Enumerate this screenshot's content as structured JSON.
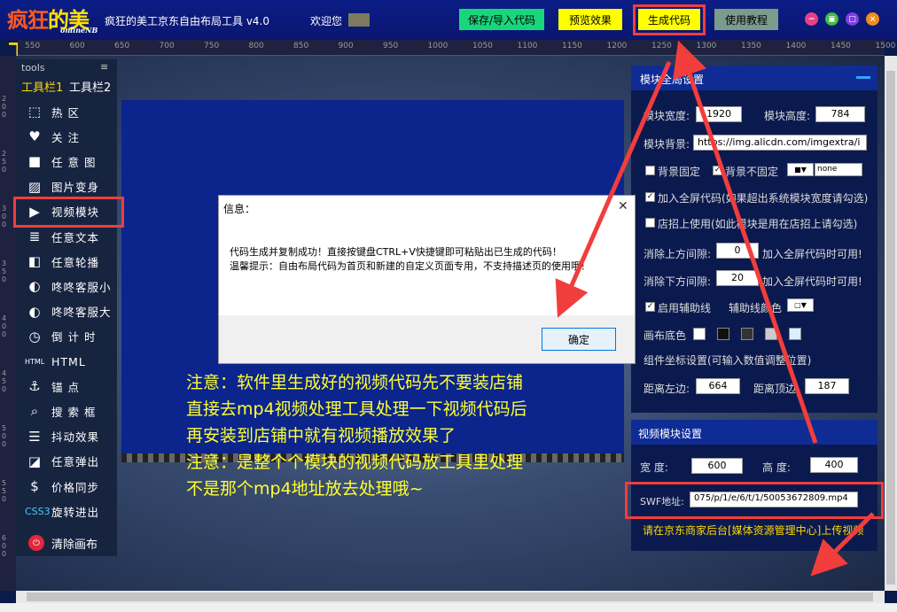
{
  "titlebar": {
    "app_title": "疯狂的美工京东自由布局工具 v4.0",
    "welcome": "欢迎您",
    "logo_main_a": "疯狂",
    "logo_main_b": "的美工",
    "logo_sub": "onlineNB",
    "buttons": {
      "save": "保存/导入代码",
      "preview": "预览效果",
      "generate": "生成代码",
      "tutorial": "使用教程"
    },
    "window": {
      "min": "−",
      "restore": "▣",
      "max": "□",
      "close": "×"
    }
  },
  "ruler_top": [
    "550",
    "600",
    "650",
    "700",
    "750",
    "800",
    "850",
    "900",
    "950",
    "1000",
    "1050",
    "1100",
    "1150",
    "1200",
    "1250",
    "1300",
    "1350",
    "1400",
    "1450",
    "1500"
  ],
  "ruler_left": [
    "200",
    "250",
    "300",
    "350",
    "400",
    "450",
    "500",
    "550",
    "600"
  ],
  "tools": {
    "title": "tools",
    "menu": "≡",
    "tab1": "工具栏1",
    "tab2": "工具栏2",
    "items": [
      {
        "icon": "⬚",
        "label": "热 区"
      },
      {
        "icon": "♥",
        "label": "关 注"
      },
      {
        "icon": "■",
        "label": "任 意 图"
      },
      {
        "icon": "▨",
        "label": "图片变身"
      },
      {
        "icon": "▶",
        "label": "视频模块"
      },
      {
        "icon": "≣",
        "label": "任意文本"
      },
      {
        "icon": "◧",
        "label": "任意轮播"
      },
      {
        "icon": "◐",
        "label": "咚咚客服小"
      },
      {
        "icon": "◐",
        "label": "咚咚客服大"
      },
      {
        "icon": "◷",
        "label": "倒 计 时"
      },
      {
        "icon": "▭",
        "label": "HTML"
      },
      {
        "icon": "⚓",
        "label": "锚 点"
      },
      {
        "icon": "⌕",
        "label": "搜 索 框"
      },
      {
        "icon": "☰",
        "label": "抖动效果"
      },
      {
        "icon": "◪",
        "label": "任意弹出"
      },
      {
        "icon": "$",
        "label": "价格同步"
      },
      {
        "icon": "✦",
        "label": "旋转进出"
      }
    ],
    "item_icon_labels": [
      "HTML",
      "CSS3"
    ],
    "clear": "清除画布",
    "clear_icon": "⏻"
  },
  "dialog": {
    "title": "信息：",
    "close": "✕",
    "message1": "代码生成并复制成功！直接按键盘CTRL+V快捷键即可粘贴出已生成的代码！",
    "message2": "温馨提示：自由布局代码为首页和新建的自定义页面专用，不支持描述页的使用哦！",
    "ok": "确定"
  },
  "notice_lines": [
    "注意：软件里生成好的视频代码先不要装店铺",
    "直接去mp4视频处理工具处理一下视频代码后",
    "再安装到店铺中就有视频播放效果了",
    "注意：是整个个模块的视频代码放工具里处理",
    "不是那个mp4地址放去处理哦~"
  ],
  "global_panel": {
    "title": "模块全局设置",
    "width_label": "模块宽度:",
    "width_value": "1920",
    "height_label": "模块高度:",
    "height_value": "784",
    "bg_label": "模块背景:",
    "bg_value": "https://img.alicdn.com/imgextra/i",
    "bg_fixed": "背景固定",
    "bg_not_fixed": "背景不固定",
    "bg_repeat": "none",
    "fullscreen": "加入全屏代码(如果超出系统模块宽度请勾选)",
    "header_use": "店招上使用(如此模块是用在店招上请勾选)",
    "top_gap_label": "消除上方间隙:",
    "top_gap_value": "0",
    "top_gap_note": "加入全屏代码时可用!",
    "bottom_gap_label": "消除下方间隙:",
    "bottom_gap_value": "20",
    "bottom_gap_note": "加入全屏代码时可用!",
    "guide_label": "启用辅助线",
    "guide_color_label": "辅助线颜色",
    "canvas_bg_label": "画布底色",
    "coord_label": "组件坐标设置(可输入数值调整位置)",
    "left_label": "距离左边:",
    "left_value": "664",
    "top_label": "距离顶边:",
    "top_value": "187",
    "canvas_colors": [
      "#ffffff",
      "#111111",
      "#333333",
      "#cccccc",
      "#ddeeff"
    ]
  },
  "video_panel": {
    "title": "视频模块设置",
    "width_label": "宽 度:",
    "width_value": "600",
    "height_label": "高 度:",
    "height_value": "400",
    "swf_label": "SWF地址:",
    "swf_value": "075/p/1/e/6/t/1/50053672809.mp4",
    "hint": "请在京东商家后台[媒体资源管理中心]上传视频"
  }
}
